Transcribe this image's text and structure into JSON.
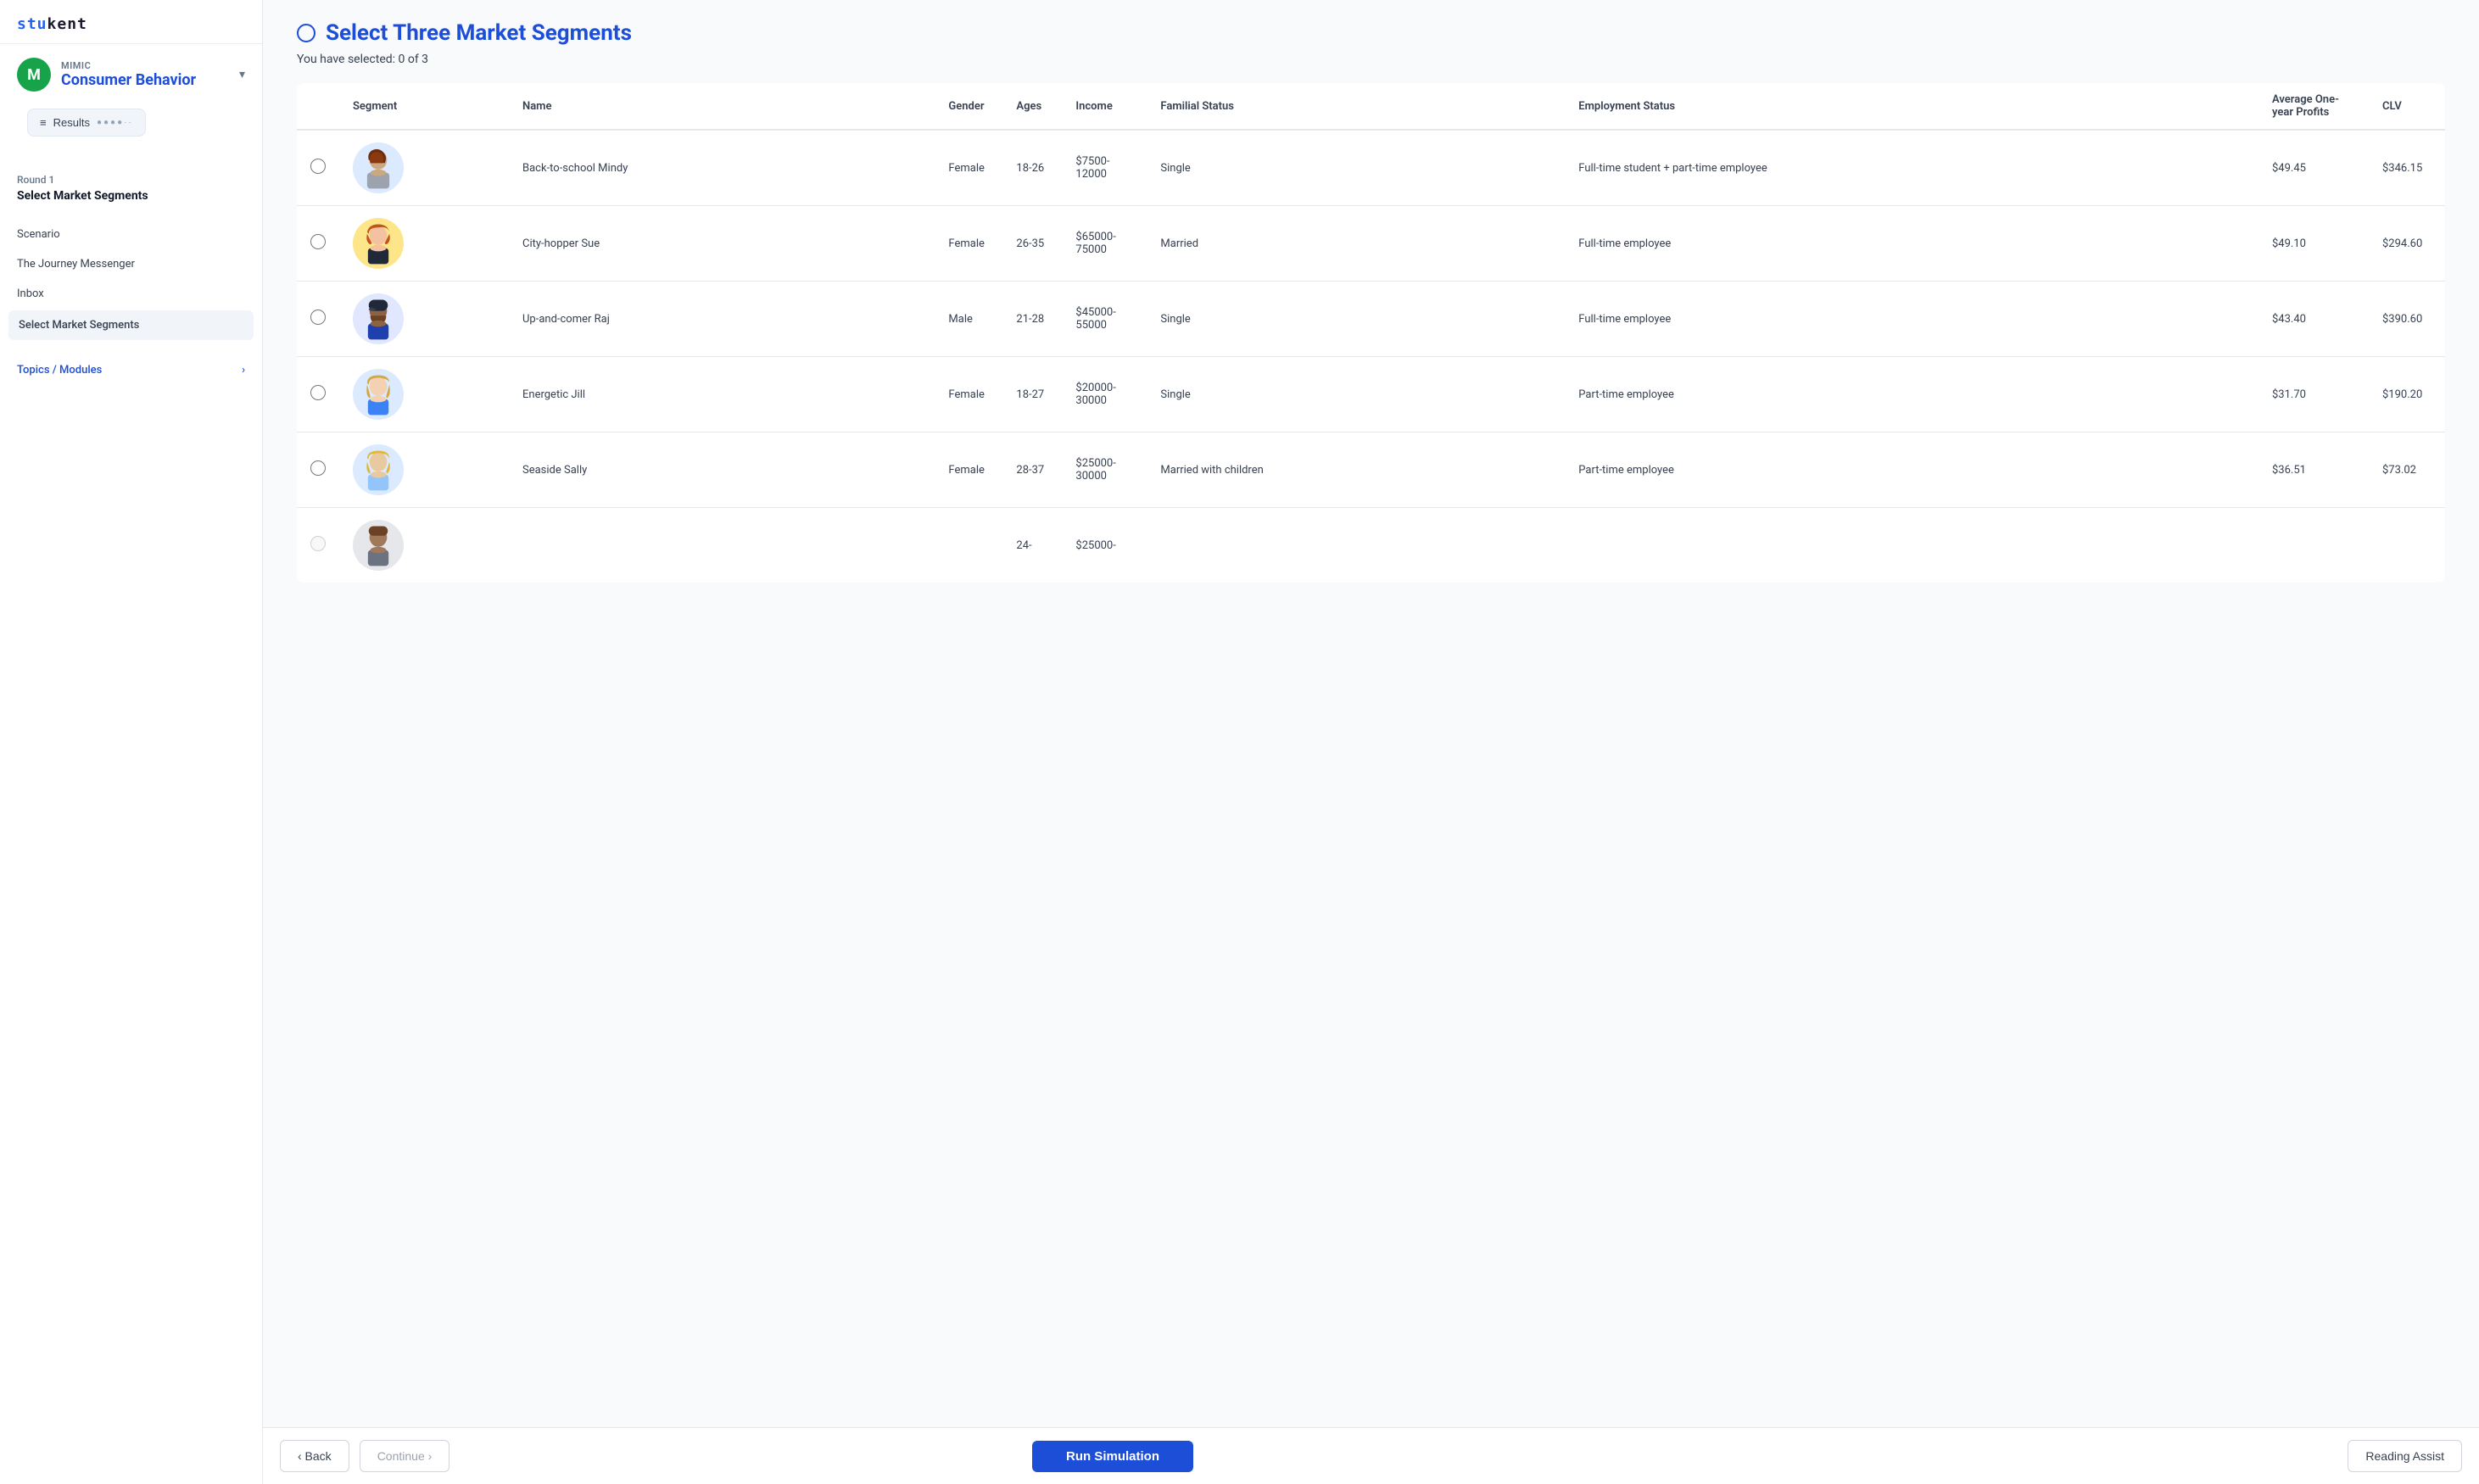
{
  "sidebar": {
    "logo": "stukent",
    "mimic_label": "MIMIC",
    "mimic_name": "Consumer Behavior",
    "results_label": "Results",
    "results_dots": "●●●●··",
    "round_label": "Round 1",
    "section_title": "Select Market Segments",
    "nav_items": [
      {
        "id": "scenario",
        "label": "Scenario"
      },
      {
        "id": "journey",
        "label": "The Journey Messenger"
      },
      {
        "id": "inbox",
        "label": "Inbox"
      },
      {
        "id": "select",
        "label": "Select Market Segments",
        "active": true
      }
    ],
    "topics_label": "Topics / Modules",
    "topics_chevron": "›"
  },
  "main": {
    "page_title": "Select Three Market Segments",
    "selected_count": "You have selected: 0 of 3",
    "columns": [
      "Segment",
      "Name",
      "Gender",
      "Ages",
      "Income",
      "Familial Status",
      "Employment Status",
      "Average One-year Profits",
      "CLV"
    ],
    "rows": [
      {
        "id": "mindy",
        "avatar_emoji": "👩",
        "avatar_class": "avatar-mindy",
        "name": "Back-to-school Mindy",
        "gender": "Female",
        "ages": "18-26",
        "income": "$7500-12000",
        "familial": "Single",
        "employment": "Full-time student + part-time employee",
        "profits": "$49.45",
        "clv": "$346.15"
      },
      {
        "id": "sue",
        "avatar_emoji": "👩‍🦰",
        "avatar_class": "avatar-sue",
        "name": "City-hopper Sue",
        "gender": "Female",
        "ages": "26-35",
        "income": "$65000-75000",
        "familial": "Married",
        "employment": "Full-time employee",
        "profits": "$49.10",
        "clv": "$294.60"
      },
      {
        "id": "raj",
        "avatar_emoji": "🧔",
        "avatar_class": "avatar-raj",
        "name": "Up-and-comer Raj",
        "gender": "Male",
        "ages": "21-28",
        "income": "$45000-55000",
        "familial": "Single",
        "employment": "Full-time employee",
        "profits": "$43.40",
        "clv": "$390.60"
      },
      {
        "id": "jill",
        "avatar_emoji": "👱‍♀️",
        "avatar_class": "avatar-jill",
        "name": "Energetic Jill",
        "gender": "Female",
        "ages": "18-27",
        "income": "$20000-30000",
        "familial": "Single",
        "employment": "Part-time employee",
        "profits": "$31.70",
        "clv": "$190.20"
      },
      {
        "id": "sally",
        "avatar_emoji": "👱‍♀️",
        "avatar_class": "avatar-sally",
        "name": "Seaside Sally",
        "gender": "Female",
        "ages": "28-37",
        "income": "$25000-30000",
        "familial": "Married with children",
        "employment": "Part-time employee",
        "profits": "$36.51",
        "clv": "$73.02"
      },
      {
        "id": "partial",
        "avatar_emoji": "🧑",
        "avatar_class": "avatar-partial",
        "name": "",
        "gender": "",
        "ages": "24-",
        "income": "$25000-",
        "familial": "",
        "employment": "",
        "profits": "",
        "clv": ""
      }
    ]
  },
  "footer": {
    "back_label": "‹ Back",
    "continue_label": "Continue ›",
    "run_label": "Run Simulation",
    "reading_label": "Reading Assist"
  }
}
